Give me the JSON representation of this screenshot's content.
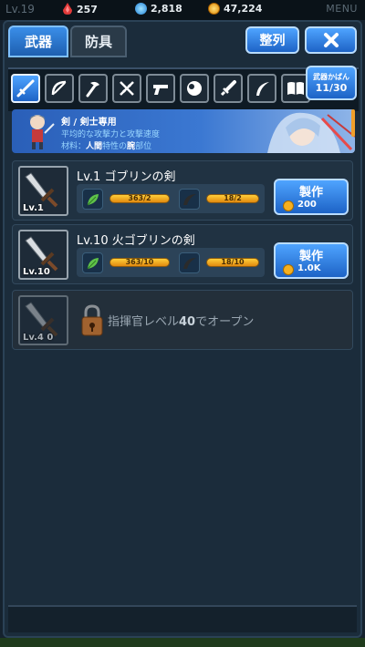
{
  "topbar": {
    "level": "Lv.19",
    "red_gem": "257",
    "blue_gem": "2,818",
    "gold": "47,224",
    "menu": "MENU"
  },
  "tabs": {
    "weapon": "武器",
    "armor": "防具"
  },
  "sort_button": "整列",
  "close_icon": "close-icon",
  "weapon_types": [
    {
      "icon": "sword-icon",
      "active": true
    },
    {
      "icon": "bow-icon",
      "active": false
    },
    {
      "icon": "hammer-icon",
      "active": false
    },
    {
      "icon": "dual-blades-icon",
      "active": false
    },
    {
      "icon": "gun-icon",
      "active": false
    },
    {
      "icon": "orb-icon",
      "active": false
    },
    {
      "icon": "dagger-icon",
      "active": false
    },
    {
      "icon": "boomerang-icon",
      "active": false
    },
    {
      "icon": "book-icon",
      "active": false
    }
  ],
  "collection": {
    "label": "武器かばん",
    "count": "11/30"
  },
  "banner": {
    "title": "剣 / 剣士専用",
    "desc": "平均的な攻撃力と攻撃速度",
    "material_prefix": "材料：",
    "material_a": "人間",
    "material_mid": "特性の",
    "material_b": "腕",
    "material_suffix": "部位"
  },
  "recipes": [
    {
      "slot_level": "Lv.1",
      "name": "Lv.1  ゴブリンの剣",
      "mat1": "363/2",
      "mat2": "18/2",
      "craft_label": "製作",
      "price": "200"
    },
    {
      "slot_level": "Lv.10",
      "name": "Lv.10  火ゴブリンの剣",
      "mat1": "363/10",
      "mat2": "18/10",
      "craft_label": "製作",
      "price": "1.0K"
    }
  ],
  "locked": {
    "slot_level": "Lv.4 0",
    "text_prefix": "指揮官レベル",
    "text_level": "40",
    "text_suffix": "でオープン"
  },
  "colors": {
    "accent": "#2f7fe0",
    "gold_bar": "#f0a822",
    "panel": "#1b2c3b"
  }
}
